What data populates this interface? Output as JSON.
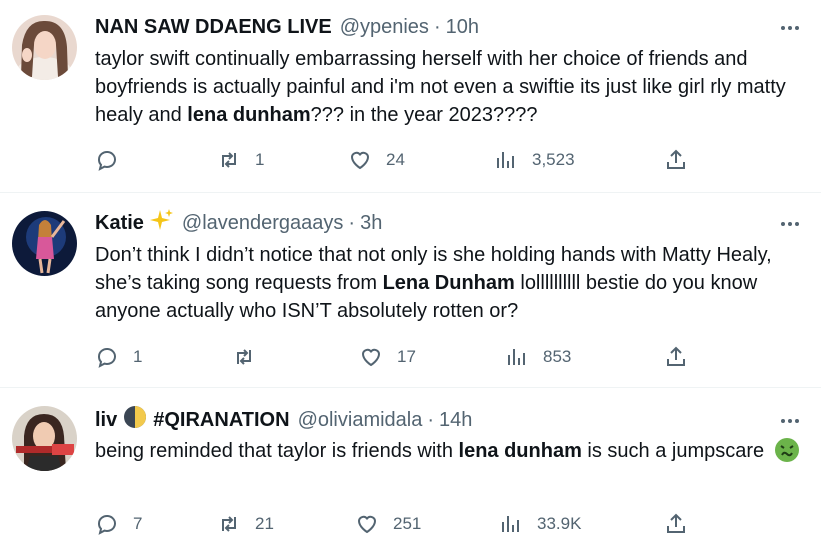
{
  "tweets": [
    {
      "name": "NAN SAW DDAENG LIVE",
      "handle": "@ypenies",
      "time": "10h",
      "body": [
        {
          "t": "taylor swift continually embarrassing herself with her choice of friends and boyfriends is actually painful and i'm not even a swiftie its just like girl rly matty healy and ",
          "b": false
        },
        {
          "t": "lena dunham",
          "b": true
        },
        {
          "t": "??? in the year 2023????",
          "b": false
        }
      ],
      "replies": "",
      "retweets": "1",
      "likes": "24",
      "views": "3,523"
    },
    {
      "name": "Katie",
      "name_emoji": "sparkles-icon",
      "handle": "@lavendergaaays",
      "time": "3h",
      "body": [
        {
          "t": "Don’t think I didn’t notice that not only is she holding hands with Matty Healy, she’s taking song requests from ",
          "b": false
        },
        {
          "t": "Lena Dunham",
          "b": true
        },
        {
          "t": " lollllllllll bestie do you know anyone actually who ISN’T absolutely rotten or?",
          "b": false
        }
      ],
      "replies": "1",
      "retweets": "",
      "likes": "17",
      "views": "853"
    },
    {
      "name": "liv",
      "name_emoji": "half-moon-icon",
      "name_suffix": "#QIRANATION",
      "handle": "@oliviamidala",
      "time": "14h",
      "body": [
        {
          "t": "being reminded that taylor is friends with ",
          "b": false
        },
        {
          "t": "lena dunham",
          "b": true
        },
        {
          "t": " is such a jumpscare ",
          "b": false
        }
      ],
      "body_emoji": "nauseated-face-icon",
      "replies": "7",
      "retweets": "21",
      "likes": "251",
      "views": "33.9K"
    }
  ],
  "colors": {
    "text": "#0f1419",
    "muted": "#536471",
    "divider": "#eff3f4",
    "sparkle": "#f5c518",
    "nausea_green": "#6bb34a"
  },
  "layout_note": ""
}
